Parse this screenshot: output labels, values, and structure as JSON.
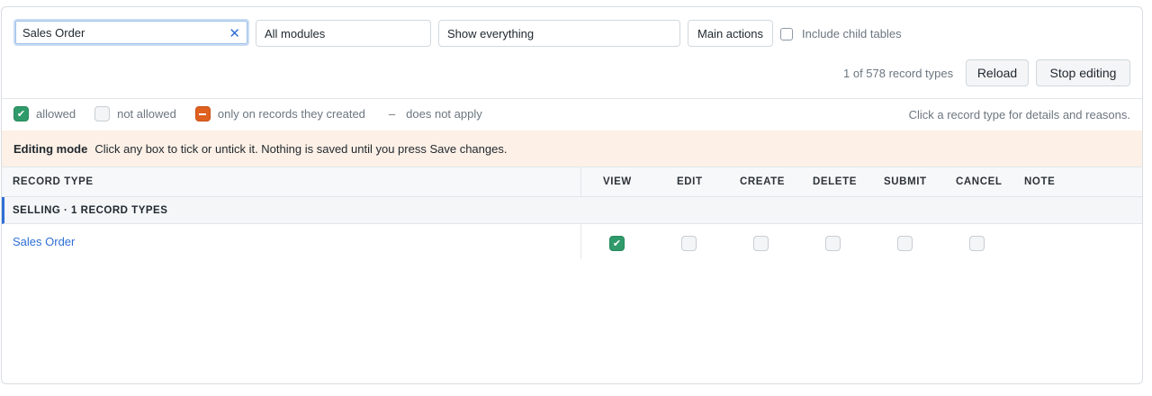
{
  "toolbar": {
    "search_value": "Sales Order",
    "module_select": "All modules",
    "show_select": "Show everything",
    "main_actions_label": "Main actions",
    "include_child_label": "Include child tables",
    "record_count": "1 of 578 record types",
    "reload_label": "Reload",
    "stop_editing_label": "Stop editing"
  },
  "legend": {
    "allowed": "allowed",
    "not_allowed": "not allowed",
    "own_only": "only on records they created",
    "na_symbol": "–",
    "na": "does not apply",
    "hint": "Click a record type for details and reasons."
  },
  "banner": {
    "title": "Editing mode",
    "text": "Click any box to tick or untick it. Nothing is saved until you press Save changes."
  },
  "table": {
    "headers": [
      "RECORD TYPE",
      "VIEW",
      "EDIT",
      "CREATE",
      "DELETE",
      "SUBMIT",
      "CANCEL",
      "NOTE"
    ],
    "group_label": "SELLING · 1 RECORD TYPES",
    "rows": [
      {
        "name": "Sales Order",
        "view": "allowed",
        "edit": "not allowed",
        "create": "not allowed",
        "delete": "not allowed",
        "submit": "not allowed",
        "cancel": "not allowed",
        "note": ""
      }
    ]
  },
  "colors": {
    "accent": "#2f6fd6",
    "allowed": "#2f9a6a",
    "own_only": "#e0601f",
    "banner_bg": "#fdf0e6"
  },
  "icons": {
    "clear": "close-icon",
    "check": "check-icon"
  }
}
